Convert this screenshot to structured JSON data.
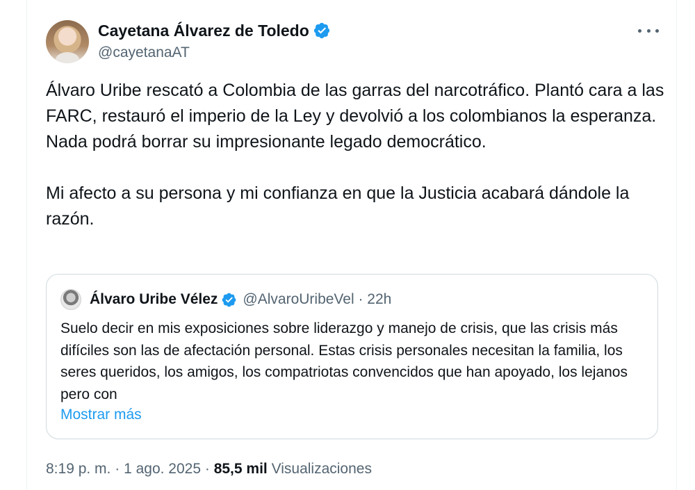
{
  "author": {
    "name": "Cayetana Álvarez de Toledo",
    "handle": "@cayetanaAT",
    "verified_icon": "verified-badge-icon",
    "verified_color": "#1d9bf0"
  },
  "tweet": {
    "paragraphs": [
      "Álvaro Uribe rescató a Colombia de las garras del narcotráfico. Plantó cara a las FARC, restauró el imperio de la Ley y devolvió a los colombianos la esperanza. Nada podrá borrar su impresionante legado democrático.",
      "Mi afecto a su persona y mi confianza en que la Justicia acabará dándole la razón."
    ]
  },
  "quoted": {
    "name": "Álvaro Uribe Vélez",
    "handle_time": "@AlvaroUribeVel · 22h",
    "text": "Suelo decir en mis exposiciones sobre liderazgo y manejo de crisis, que las crisis más difíciles son las de afectación personal. Estas crisis personales necesitan la familia, los seres queridos, los amigos, los compatriotas convencidos que han apoyado, los lejanos pero con",
    "show_more": "Mostrar más"
  },
  "meta": {
    "time": "8:19 p. m.",
    "separator": "·",
    "date": "1 ago. 2025",
    "views_count": "85,5 mil",
    "views_label": "Visualizaciones"
  },
  "colors": {
    "text_primary": "#0f1419",
    "text_secondary": "#536471",
    "link": "#1d9bf0",
    "border": "#cfd9de"
  }
}
